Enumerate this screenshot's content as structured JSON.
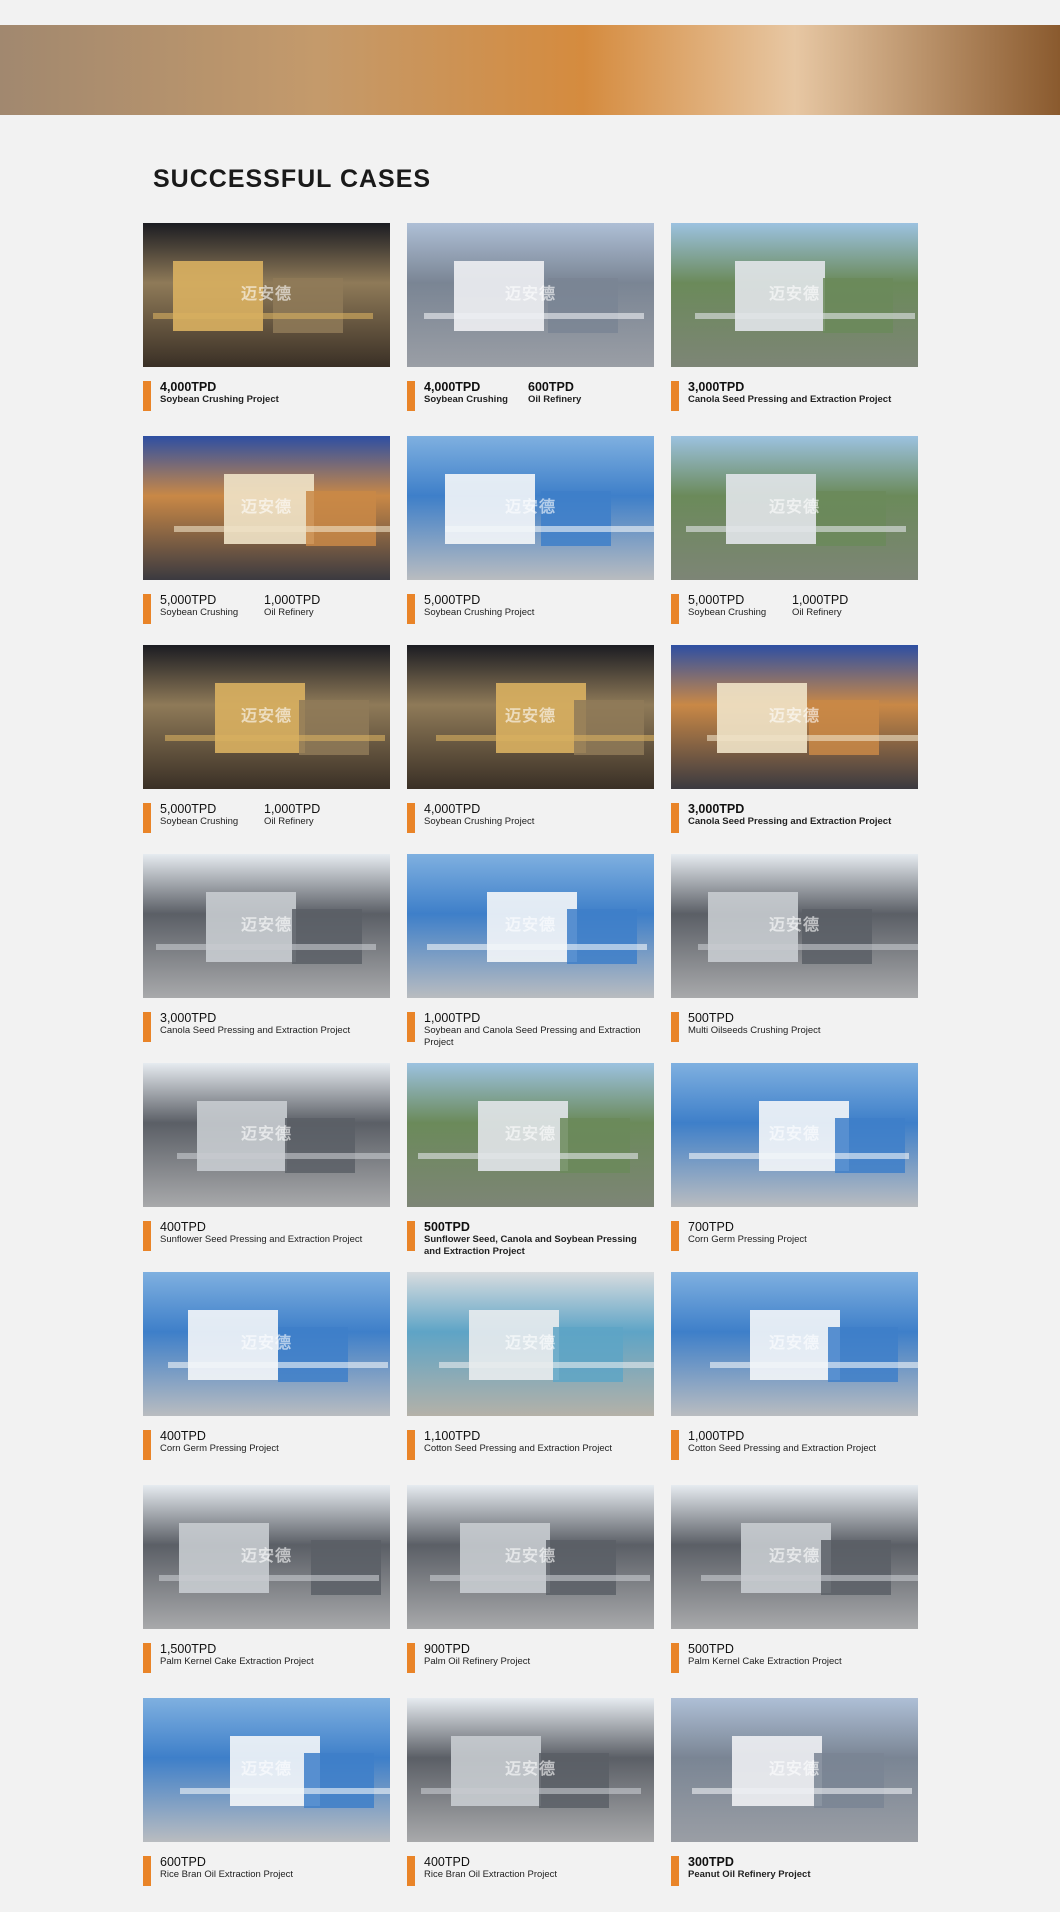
{
  "page": {
    "section_title": "SUCCESSFUL CASES",
    "watermark": "迈安德"
  },
  "colors": {
    "accent": "#e98428",
    "background": "#f2f2f2"
  },
  "cases": [
    {
      "bold": true,
      "items": [
        {
          "title": "4,000TPD",
          "sub": "Soybean Crushing Project"
        }
      ],
      "tone": "night"
    },
    {
      "bold": true,
      "items": [
        {
          "title": "4,000TPD",
          "sub": "Soybean Crushing"
        },
        {
          "title": "600TPD",
          "sub": "Oil Refinery"
        }
      ],
      "tone": "silver"
    },
    {
      "bold": true,
      "items": [
        {
          "title": "3,000TPD",
          "sub": "Canola Seed Pressing and Extraction Project"
        }
      ],
      "tone": "aerial"
    },
    {
      "bold": false,
      "items": [
        {
          "title": "5,000TPD",
          "sub": "Soybean Crushing"
        },
        {
          "title": "1,000TPD",
          "sub": "Oil Refinery"
        }
      ],
      "tone": "dusk"
    },
    {
      "bold": false,
      "items": [
        {
          "title": "5,000TPD",
          "sub": "Soybean Crushing Project"
        }
      ],
      "tone": "day"
    },
    {
      "bold": false,
      "items": [
        {
          "title": "5,000TPD",
          "sub": "Soybean Crushing"
        },
        {
          "title": "1,000TPD",
          "sub": "Oil Refinery"
        }
      ],
      "tone": "aerial"
    },
    {
      "bold": false,
      "items": [
        {
          "title": "5,000TPD",
          "sub": "Soybean Crushing"
        },
        {
          "title": "1,000TPD",
          "sub": "Oil Refinery"
        }
      ],
      "tone": "night"
    },
    {
      "bold": false,
      "items": [
        {
          "title": "4,000TPD",
          "sub": "Soybean Crushing Project"
        }
      ],
      "tone": "night"
    },
    {
      "bold": true,
      "items": [
        {
          "title": "3,000TPD",
          "sub": "Canola Seed Pressing and Extraction Project"
        }
      ],
      "tone": "dusk"
    },
    {
      "bold": false,
      "items": [
        {
          "title": "3,000TPD",
          "sub": "Canola Seed Pressing and Extraction Project"
        }
      ],
      "tone": "white"
    },
    {
      "bold": false,
      "items": [
        {
          "title": "1,000TPD",
          "sub": "Soybean and Canola Seed Pressing and Extraction Project"
        }
      ],
      "tone": "day"
    },
    {
      "bold": false,
      "items": [
        {
          "title": "500TPD",
          "sub": "Multi Oilseeds Crushing Project"
        }
      ],
      "tone": "white"
    },
    {
      "bold": false,
      "items": [
        {
          "title": "400TPD",
          "sub": "Sunflower Seed Pressing and Extraction Project"
        }
      ],
      "tone": "white"
    },
    {
      "bold": true,
      "items": [
        {
          "title": "500TPD",
          "sub": "Sunflower Seed, Canola and Soybean Pressing and Extraction Project"
        }
      ],
      "tone": "aerial"
    },
    {
      "bold": false,
      "items": [
        {
          "title": "700TPD",
          "sub": "Corn Germ Pressing Project"
        }
      ],
      "tone": "day"
    },
    {
      "bold": false,
      "items": [
        {
          "title": "400TPD",
          "sub": "Corn Germ Pressing Project"
        }
      ],
      "tone": "day"
    },
    {
      "bold": false,
      "items": [
        {
          "title": "1,100TPD",
          "sub": "Cotton Seed Pressing and Extraction Project"
        }
      ],
      "tone": "haze"
    },
    {
      "bold": false,
      "items": [
        {
          "title": "1,000TPD",
          "sub": "Cotton Seed Pressing and Extraction Project"
        }
      ],
      "tone": "day"
    },
    {
      "bold": false,
      "items": [
        {
          "title": "1,500TPD",
          "sub": "Palm Kernel Cake Extraction Project"
        }
      ],
      "tone": "white"
    },
    {
      "bold": false,
      "items": [
        {
          "title": "900TPD",
          "sub": "Palm Oil Refinery Project"
        }
      ],
      "tone": "white"
    },
    {
      "bold": false,
      "items": [
        {
          "title": "500TPD",
          "sub": "Palm Kernel Cake Extraction Project"
        }
      ],
      "tone": "white"
    },
    {
      "bold": false,
      "items": [
        {
          "title": "600TPD",
          "sub": "Rice Bran Oil Extraction Project"
        }
      ],
      "tone": "day"
    },
    {
      "bold": false,
      "items": [
        {
          "title": "400TPD",
          "sub": "Rice Bran Oil Extraction Project"
        }
      ],
      "tone": "white"
    },
    {
      "bold": true,
      "items": [
        {
          "title": "300TPD",
          "sub": "Peanut Oil Refinery Project"
        }
      ],
      "tone": "silver"
    }
  ]
}
